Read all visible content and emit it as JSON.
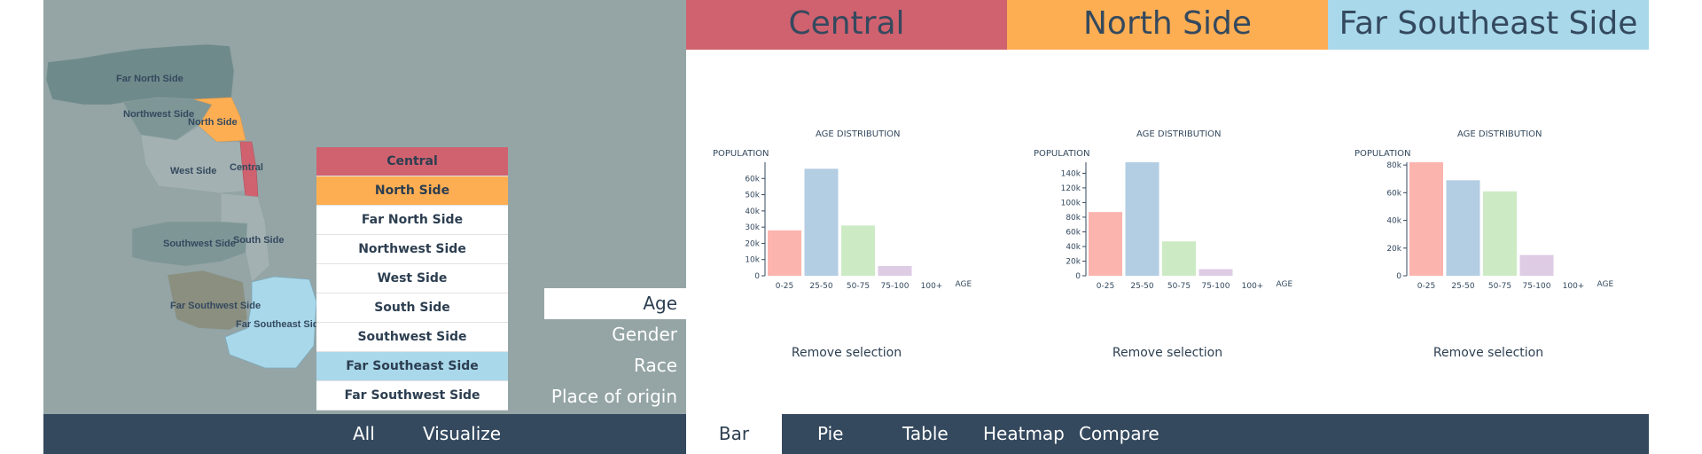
{
  "colors": {
    "central": "#d0626f",
    "north_side": "#fdae53",
    "far_southeast_side": "#a9d8ea",
    "map_bg": "#95a5a6",
    "nav_bg": "#34495e",
    "bar_colors": [
      "#fbb4ae",
      "#b3cde3",
      "#ccebc5",
      "#decbe4",
      "#fed9a6"
    ]
  },
  "map": {
    "labels": {
      "far_north_side": "Far North Side",
      "northwest_side": "Northwest Side",
      "north_side": "North Side",
      "west_side": "West Side",
      "central": "Central",
      "southwest_side": "Southwest Side",
      "south_side": "South Side",
      "far_southwest_side": "Far Southwest Side",
      "far_southeast_side": "Far Southeast Side"
    }
  },
  "regions": [
    {
      "label": "Central",
      "color": "#d0626f"
    },
    {
      "label": "North Side",
      "color": "#fdae53"
    },
    {
      "label": "Far North Side",
      "color": "#ffffff"
    },
    {
      "label": "Northwest Side",
      "color": "#ffffff"
    },
    {
      "label": "West Side",
      "color": "#ffffff"
    },
    {
      "label": "South Side",
      "color": "#ffffff"
    },
    {
      "label": "Southwest Side",
      "color": "#ffffff"
    },
    {
      "label": "Far Southeast Side",
      "color": "#a9d8ea"
    },
    {
      "label": "Far Southwest Side",
      "color": "#ffffff"
    }
  ],
  "attributes": [
    {
      "label": "Age",
      "active": true
    },
    {
      "label": "Gender",
      "active": false
    },
    {
      "label": "Race",
      "active": false
    },
    {
      "label": "Place of origin",
      "active": false
    }
  ],
  "left_nav": {
    "all": "All",
    "visualize": "Visualize"
  },
  "right_nav": {
    "items": [
      {
        "label": "Bar",
        "active": true
      },
      {
        "label": "Pie",
        "active": false
      },
      {
        "label": "Table",
        "active": false
      },
      {
        "label": "Heatmap",
        "active": false
      },
      {
        "label": "Compare",
        "active": false
      }
    ]
  },
  "columns": [
    {
      "title": "Central",
      "color": "#d0626f",
      "remove_label": "Remove selection"
    },
    {
      "title": "North Side",
      "color": "#fdae53",
      "remove_label": "Remove selection"
    },
    {
      "title": "Far Southeast Side",
      "color": "#a9d8ea",
      "remove_label": "Remove selection"
    }
  ],
  "chart_data": [
    {
      "type": "bar",
      "title": "AGE DISTRIBUTION",
      "ylabel": "POPULATION",
      "xlabel": "AGE",
      "categories": [
        "0-25",
        "25-50",
        "50-75",
        "75-100",
        "100+"
      ],
      "values": [
        28000,
        66000,
        31000,
        6000,
        0
      ],
      "ylim": [
        0,
        70000
      ],
      "yticks": [
        0,
        10000,
        20000,
        30000,
        40000,
        50000,
        60000
      ],
      "ytick_labels": [
        "0",
        "10k",
        "20k",
        "30k",
        "40k",
        "50k",
        "60k"
      ]
    },
    {
      "type": "bar",
      "title": "AGE DISTRIBUTION",
      "ylabel": "POPULATION",
      "xlabel": "AGE",
      "categories": [
        "0-25",
        "25-50",
        "50-75",
        "75-100",
        "100+"
      ],
      "values": [
        87000,
        155000,
        47000,
        9000,
        0
      ],
      "ylim": [
        0,
        155000
      ],
      "yticks": [
        0,
        20000,
        40000,
        60000,
        80000,
        100000,
        120000,
        140000
      ],
      "ytick_labels": [
        "0",
        "20k",
        "40k",
        "60k",
        "80k",
        "100k",
        "120k",
        "140k"
      ]
    },
    {
      "type": "bar",
      "title": "AGE DISTRIBUTION",
      "ylabel": "POPULATION",
      "xlabel": "AGE",
      "categories": [
        "0-25",
        "25-50",
        "50-75",
        "75-100",
        "100+"
      ],
      "values": [
        82000,
        69000,
        61000,
        15000,
        0
      ],
      "ylim": [
        0,
        82000
      ],
      "yticks": [
        0,
        20000,
        40000,
        60000,
        80000
      ],
      "ytick_labels": [
        "0",
        "20k",
        "40k",
        "60k",
        "80k"
      ]
    }
  ]
}
